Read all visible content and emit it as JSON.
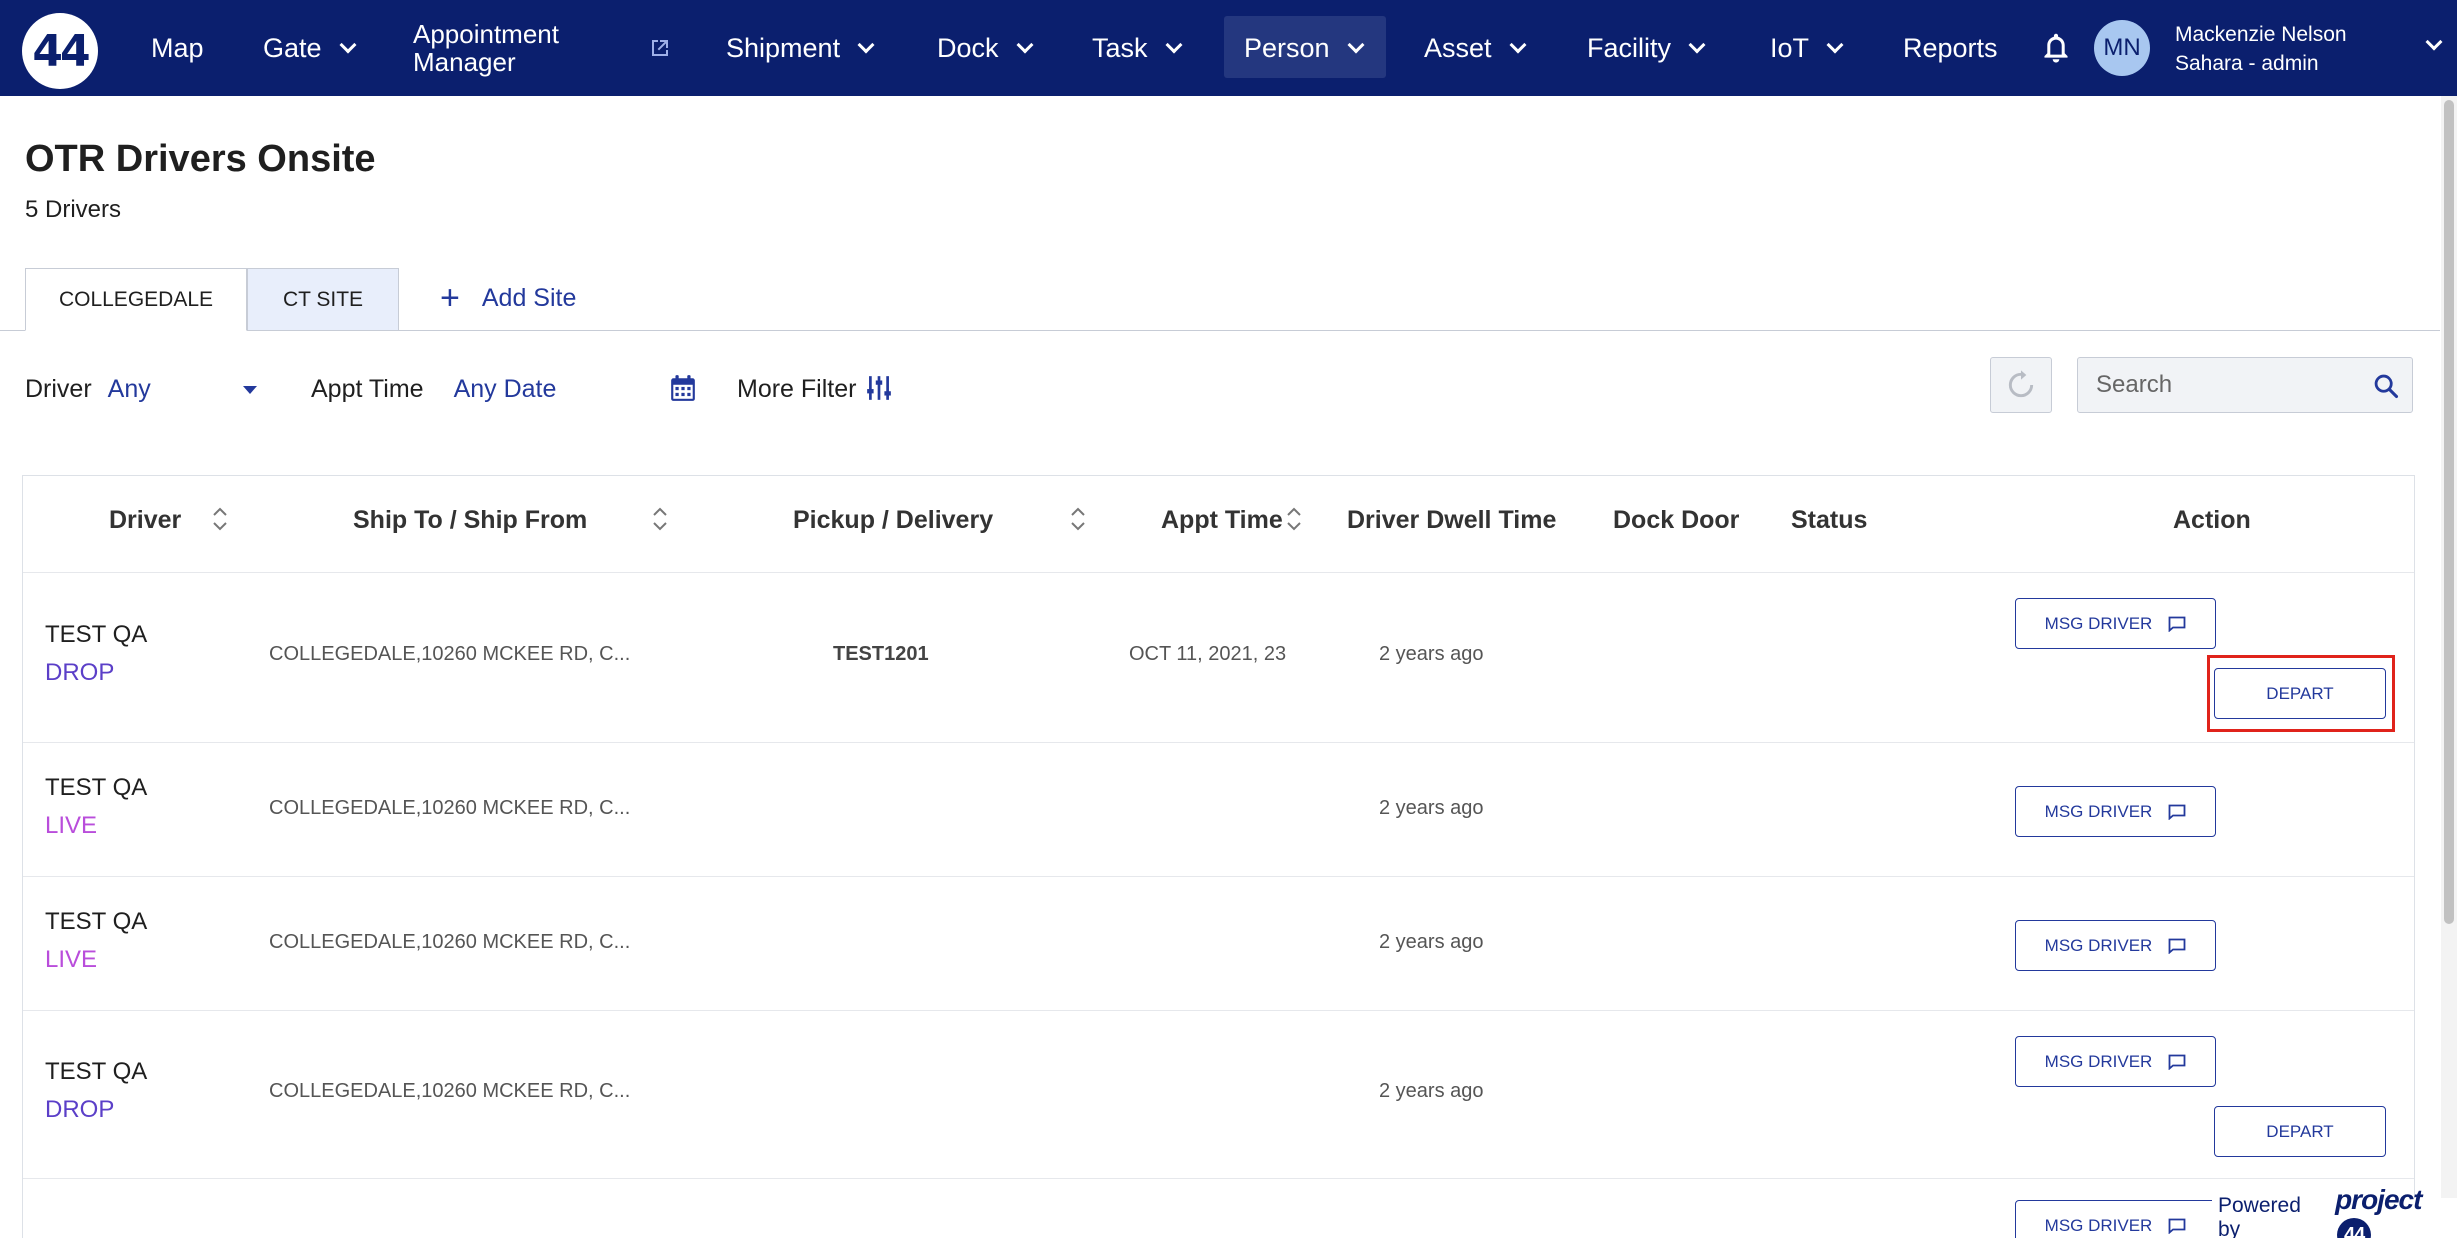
{
  "nav": {
    "logo": "44",
    "items": {
      "map": "Map",
      "gate": "Gate",
      "appointment_line1": "Appointment",
      "appointment_line2": "Manager",
      "shipment": "Shipment",
      "dock": "Dock",
      "task": "Task",
      "person": "Person",
      "asset": "Asset",
      "facility": "Facility",
      "iot": "IoT",
      "reports": "Reports"
    },
    "active_item": "Person",
    "user": {
      "initials": "MN",
      "name": "Mackenzie Nelson",
      "role": "Sahara - admin"
    }
  },
  "header": {
    "title": "OTR Drivers Onsite",
    "subtitle": "5 Drivers"
  },
  "tabs": [
    {
      "label": "COLLEGEDALE",
      "active": true
    },
    {
      "label": "CT SITE",
      "active": false
    }
  ],
  "add_site_label": "Add Site",
  "filters": {
    "driver_label": "Driver",
    "driver_value": "Any",
    "appt_label": "Appt Time",
    "appt_value": "Any Date",
    "more_filter": "More Filter"
  },
  "search": {
    "placeholder": "Search"
  },
  "table": {
    "columns": {
      "driver": "Driver",
      "ship": "Ship To / Ship From",
      "pickup": "Pickup / Delivery",
      "appt": "Appt Time",
      "dwell": "Driver Dwell Time",
      "dock": "Dock Door",
      "status": "Status",
      "action": "Action"
    },
    "rows": [
      {
        "driver": "TEST QA",
        "type": "DROP",
        "ship": "COLLEGEDALE,10260 MCKEE RD, C...",
        "pickup": "TEST1201",
        "appt": "OCT 11, 2021, 23",
        "dwell": "2 years ago",
        "msg": "MSG DRIVER",
        "depart": "DEPART"
      },
      {
        "driver": "TEST QA",
        "type": "LIVE",
        "ship": "COLLEGEDALE,10260 MCKEE RD, C...",
        "pickup": "",
        "appt": "",
        "dwell": "2 years ago",
        "msg": "MSG DRIVER"
      },
      {
        "driver": "TEST QA",
        "type": "LIVE",
        "ship": "COLLEGEDALE,10260 MCKEE RD, C...",
        "pickup": "",
        "appt": "",
        "dwell": "2 years ago",
        "msg": "MSG DRIVER"
      },
      {
        "driver": "TEST QA",
        "type": "DROP",
        "ship": "COLLEGEDALE,10260 MCKEE RD, C...",
        "pickup": "",
        "appt": "",
        "dwell": "2 years ago",
        "msg": "MSG DRIVER",
        "depart": "DEPART"
      },
      {
        "driver": "",
        "type": "",
        "ship": "",
        "pickup": "",
        "appt": "",
        "dwell": "",
        "msg": "MSG DRIVER"
      }
    ]
  },
  "powered_by": {
    "label": "Powered by",
    "brand": "project",
    "brand_num": "44"
  },
  "colors": {
    "nav_bg": "#0b1f6e",
    "accent": "#23399c",
    "drop": "#5b3fc8",
    "live": "#b94ddb",
    "highlight": "#e0231b"
  }
}
